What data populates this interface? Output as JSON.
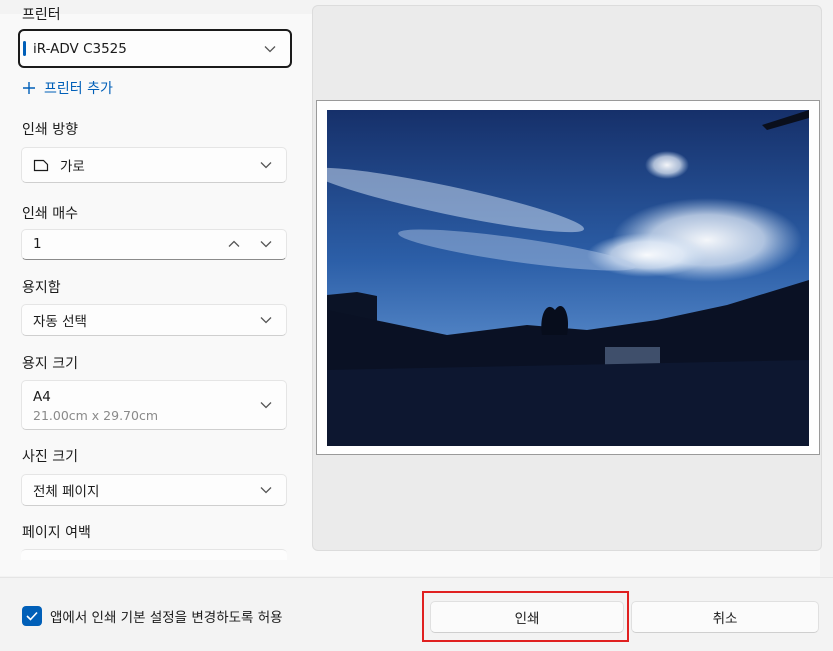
{
  "printer": {
    "label": "프린터",
    "selected": "iR-ADV C3525",
    "add_printer": "프린터 추가"
  },
  "orientation": {
    "label": "인쇄 방향",
    "value": "가로",
    "icon": "page-orientation-icon"
  },
  "copies": {
    "label": "인쇄 매수",
    "value": "1"
  },
  "paper_tray": {
    "label": "용지함",
    "value": "자동 선택"
  },
  "paper_size": {
    "label": "용지 크기",
    "value": "A4",
    "dimensions": "21.00cm x 29.70cm"
  },
  "photo_size": {
    "label": "사진 크기",
    "value": "전체 페이지"
  },
  "margins": {
    "label": "페이지 여백"
  },
  "footer": {
    "checkbox_label": "앱에서 인쇄 기본 설정을 변경하도록 허용",
    "checkbox_checked": true,
    "print_button": "인쇄",
    "cancel_button": "취소"
  },
  "colors": {
    "accent": "#005fb8",
    "highlight": "#e02020"
  }
}
